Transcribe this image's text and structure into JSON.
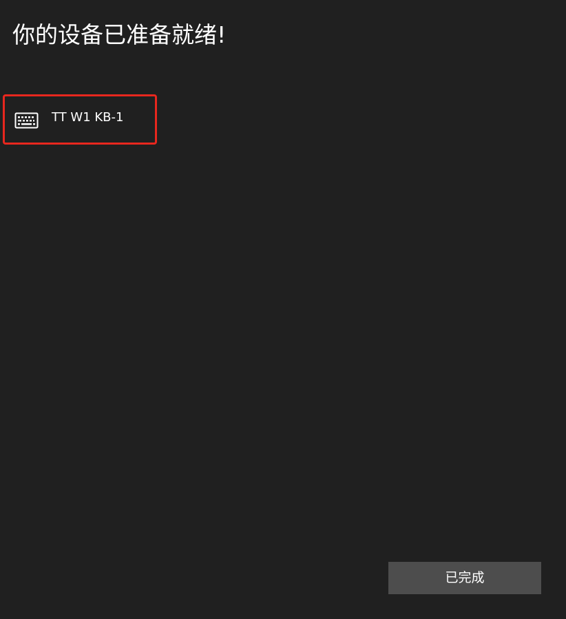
{
  "header": {
    "title": "你的设备已准备就绪!"
  },
  "devices": [
    {
      "name": "TT W1 KB-1",
      "icon": "keyboard-icon",
      "highlight_color": "#e8271e"
    }
  ],
  "footer": {
    "done_label": "已完成"
  },
  "colors": {
    "background": "#202020",
    "button": "#4d4d4d",
    "text": "#ffffff"
  }
}
